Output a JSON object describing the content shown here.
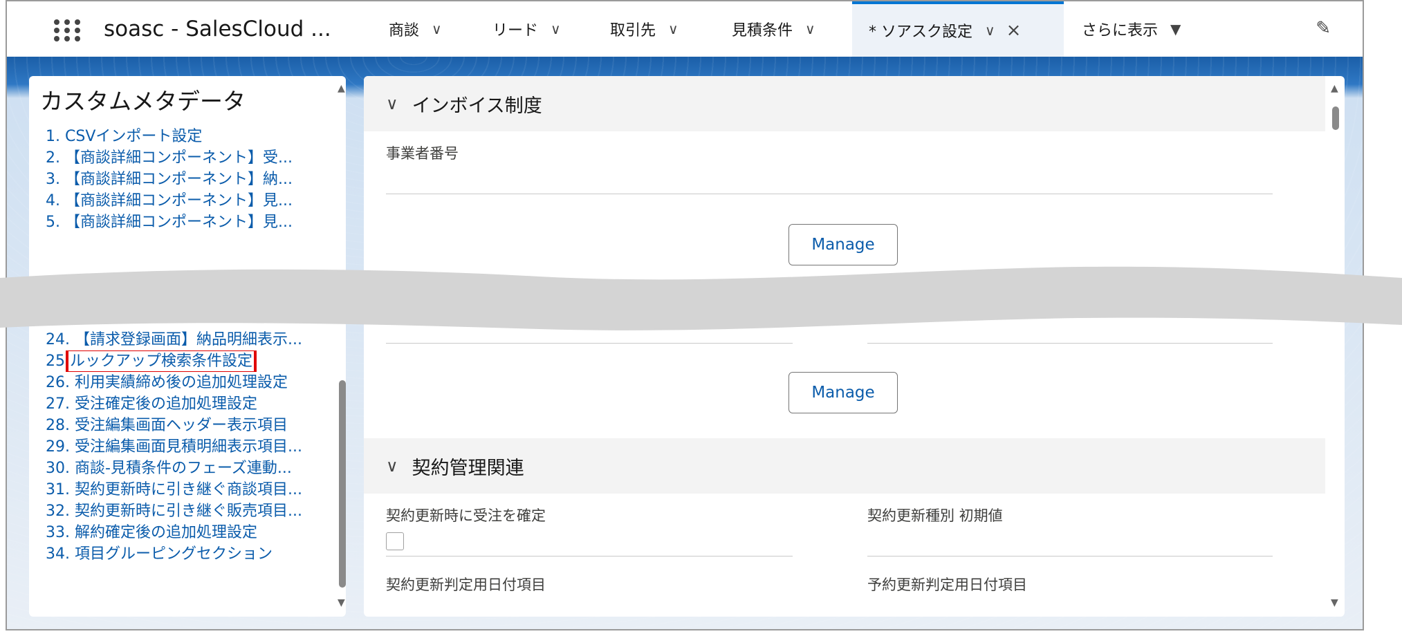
{
  "nav": {
    "app_name": "soasc - SalesCloud ...",
    "tabs": [
      {
        "label": "商談"
      },
      {
        "label": "リード"
      },
      {
        "label": "取引先"
      },
      {
        "label": "見積条件"
      },
      {
        "label": "* ソアスク設定"
      },
      {
        "label": "さらに表示"
      }
    ],
    "icons": [
      "app-launcher-icon",
      "chevron-down-icon",
      "close-icon",
      "caret-down-icon",
      "pencil-icon"
    ]
  },
  "left_panel": {
    "title": "カスタムメタデータ",
    "items_top": [
      {
        "num": "1.",
        "text": "CSVインポート設定"
      },
      {
        "num": "2.",
        "text": "【商談詳細コンポーネント】受..."
      },
      {
        "num": "3.",
        "text": "【商談詳細コンポーネント】納..."
      },
      {
        "num": "4.",
        "text": "【商談詳細コンポーネント】見..."
      },
      {
        "num": "5.",
        "text": "【商談詳細コンポーネント】見..."
      }
    ],
    "items_bottom": [
      {
        "num": "24.",
        "text": "【請求登録画面】納品明細表示..."
      },
      {
        "num": "25",
        "text": "ルックアップ検索条件設定"
      },
      {
        "num": "26.",
        "text": "利用実績締め後の追加処理設定"
      },
      {
        "num": "27.",
        "text": "受注確定後の追加処理設定"
      },
      {
        "num": "28.",
        "text": "受注編集画面ヘッダー表示項目"
      },
      {
        "num": "29.",
        "text": "受注編集画面見積明細表示項目..."
      },
      {
        "num": "30.",
        "text": "商談-見積条件のフェーズ連動..."
      },
      {
        "num": "31.",
        "text": "契約更新時に引き継ぐ商談項目..."
      },
      {
        "num": "32.",
        "text": "契約更新時に引き継ぐ販売項目..."
      },
      {
        "num": "33.",
        "text": "解約確定後の追加処理設定"
      },
      {
        "num": "34.",
        "text": "項目グルーピングセクション"
      }
    ],
    "highlighted_item": "ルックアップ検索条件設定",
    "highlight_color": "#e00000"
  },
  "right_panel": {
    "section1": {
      "title": "インボイス制度",
      "field_label": "事業者番号",
      "manage_label": "Manage"
    },
    "middle": {
      "manage_label": "Manage"
    },
    "section2": {
      "title": "契約管理関連",
      "fields": [
        {
          "label": "契約更新時に受注を確定"
        },
        {
          "label": "契約更新種別 初期値"
        },
        {
          "label": "契約更新判定用日付項目"
        },
        {
          "label": "予約更新判定用日付項目"
        }
      ]
    }
  },
  "colors": {
    "link": "#0b5cab",
    "active_tab_bg": "#edf2f8",
    "brand_blue": "#0176d3"
  }
}
